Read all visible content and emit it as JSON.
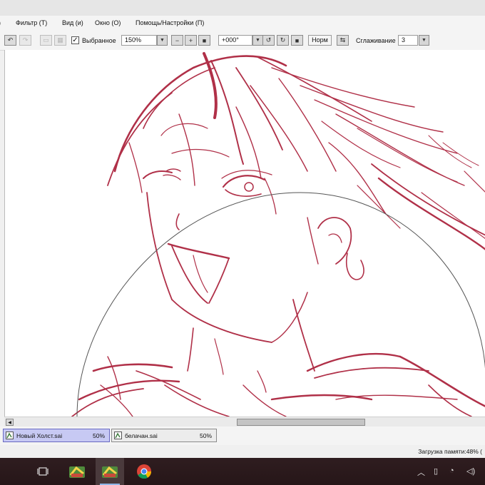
{
  "menu": {
    "items": [
      "Фильтр (T)",
      "Вид (и)",
      "Окно (О)",
      "Помощь/Настройки (П)"
    ]
  },
  "toolbar": {
    "selected_checked": true,
    "selected_label": "Выбранное",
    "zoom_value": "150%",
    "rotation_value": "+000°",
    "blend_mode": "Норм",
    "smoothing_label": "Сглаживание",
    "smoothing_value": "3"
  },
  "documents": [
    {
      "name": "Новый Холст.sai",
      "zoom": "50%",
      "active": true
    },
    {
      "name": "белачан.sai",
      "zoom": "50%",
      "active": false
    }
  ],
  "status": {
    "memory": "Загрузка памяти:48% ("
  },
  "taskbar": {
    "apps": [
      "task-view-icon",
      "paint-tool-sai-icon",
      "paint-tool-sai-icon",
      "chrome-icon"
    ],
    "tray": [
      "chevron-up-icon",
      "device-icon",
      "network-icon",
      "volume-icon"
    ]
  },
  "colors": {
    "sketch_line": "#b03048",
    "active_tab": "#c7c9f3",
    "taskbar": "#2b1a1c"
  }
}
